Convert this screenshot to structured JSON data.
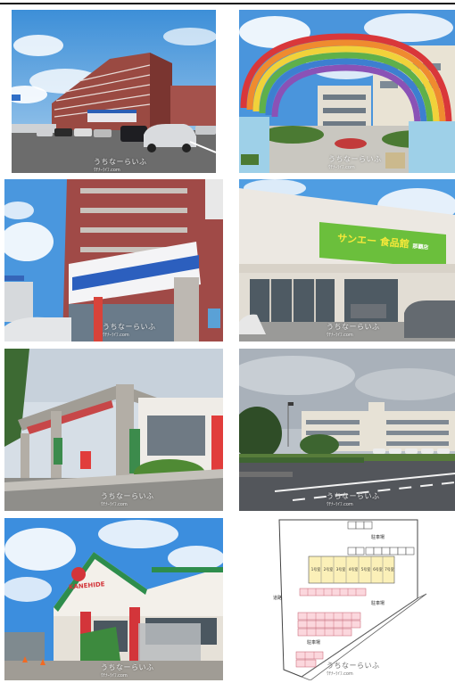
{
  "watermark": {
    "text": "うちなーらいふ",
    "sub": "ｳﾁﾅｰﾗｲﾌ.com"
  },
  "photos": [
    {
      "id": "apartment-exterior"
    },
    {
      "id": "school-rainbow-gate"
    },
    {
      "id": "convenience-store"
    },
    {
      "id": "supermarket",
      "sign": "サンエー 食品館",
      "sign_small": "那覇店"
    },
    {
      "id": "post-office"
    },
    {
      "id": "city-hall"
    },
    {
      "id": "kanehide-supermarket",
      "sign": "KANEHIDE"
    },
    {
      "id": "parking-lot-plan",
      "labels": {
        "parking_top": "駐車場",
        "parking_mid": "駐車場",
        "parking_bottom": "駐車場",
        "road": "道路",
        "building_units": [
          "1号室",
          "2号室",
          "3号室",
          "4号室",
          "5号室",
          "6号室",
          "7号室"
        ]
      }
    }
  ]
}
